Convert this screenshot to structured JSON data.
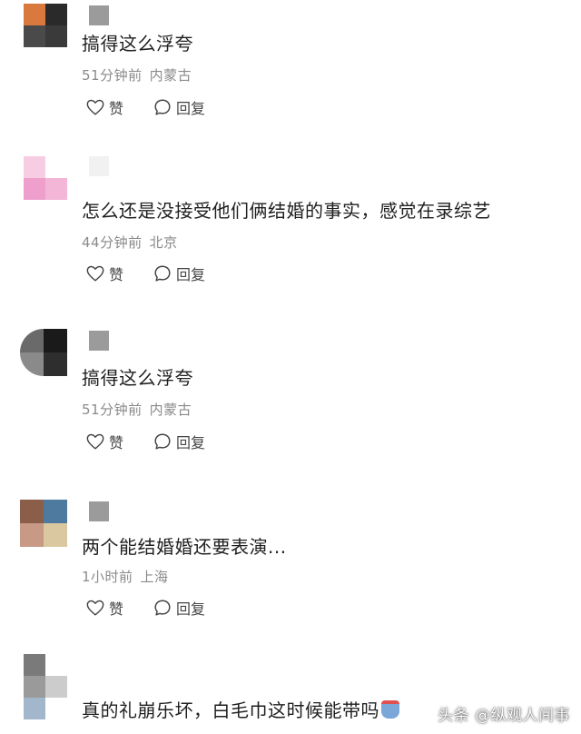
{
  "comments": [
    {
      "text": "搞得这么浮夸",
      "time": "51分钟前",
      "location": "内蒙古",
      "like_label": "赞",
      "reply_label": "回复"
    },
    {
      "text": "怎么还是没接受他们俩结婚的事实，感觉在录综艺",
      "time": "44分钟前",
      "location": "北京",
      "like_label": "赞",
      "reply_label": "回复"
    },
    {
      "text": "搞得这么浮夸",
      "time": "51分钟前",
      "location": "内蒙古",
      "like_label": "赞",
      "reply_label": "回复"
    },
    {
      "text": "两个能结婚婚还要表演...",
      "time": "1小时前",
      "location": "上海",
      "like_label": "赞",
      "reply_label": "回复"
    },
    {
      "text": "真的礼崩乐坏，白毛巾这时候能带吗",
      "time": "",
      "location": ""
    }
  ],
  "watermark": "头条 @纵观人间事",
  "icons": {
    "like": "thumbs-up-icon",
    "reply": "speech-bubble-icon",
    "emoji": "emoji-icon"
  }
}
